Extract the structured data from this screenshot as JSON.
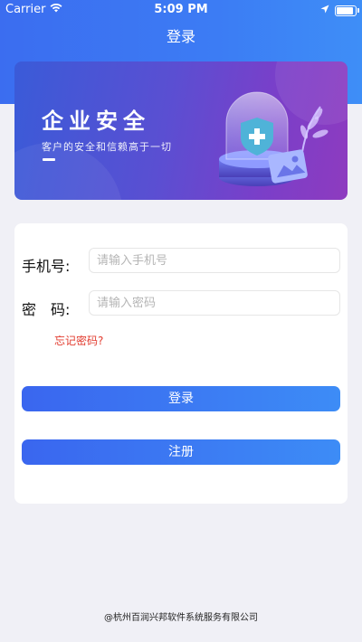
{
  "status_bar": {
    "carrier": "Carrier",
    "time": "5:09 PM",
    "battery_level": 1.0
  },
  "nav": {
    "title": "登录"
  },
  "banner": {
    "title": "企业安全",
    "subtitle": "客户的安全和信赖高于一切"
  },
  "form": {
    "phone_label": "手机号:",
    "phone_placeholder": "请输入手机号",
    "password_label": "密　码:",
    "password_placeholder": "请输入密码",
    "forgot_link": "忘记密码?",
    "login_button": "登录",
    "register_button": "注册"
  },
  "footer": {
    "copyright": "@杭州百润兴邦软件系统服务有限公司"
  },
  "colors": {
    "accent": "#3b6df0",
    "link_red": "#e23b2e",
    "background": "#f0f0f6"
  },
  "icons": [
    "wifi-icon",
    "location-arrow-icon",
    "battery-icon",
    "shield-plus-icon",
    "image-icon",
    "leaf-icon"
  ]
}
